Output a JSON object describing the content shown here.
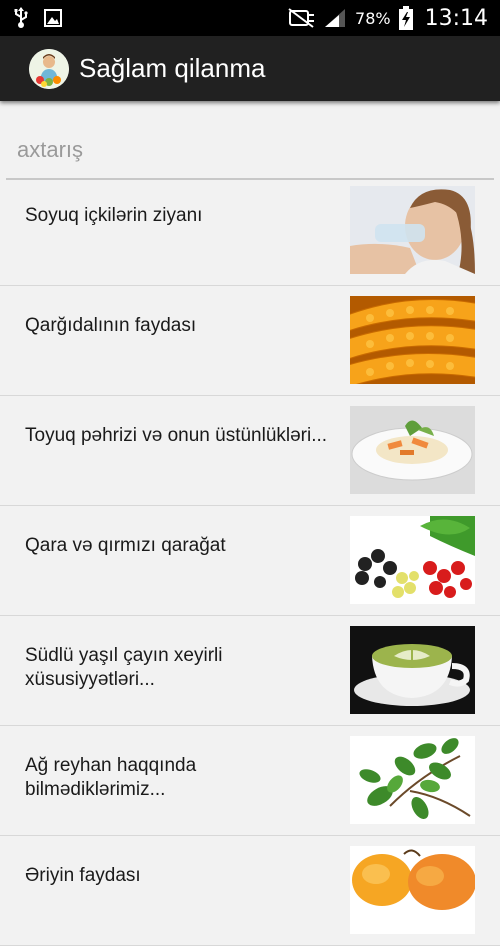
{
  "status_bar": {
    "battery_percent": "78%",
    "time": "13:14",
    "icons": [
      "usb-icon",
      "image-icon",
      "mute-icon",
      "signal-icon",
      "battery-charging-icon"
    ]
  },
  "app_bar": {
    "title": "Sağlam qilanma",
    "logo": "app-logo-icon"
  },
  "search": {
    "placeholder": "axtarış"
  },
  "list": {
    "items": [
      {
        "title": "Soyuq içkilərin ziyanı",
        "image": "woman-drinking-water"
      },
      {
        "title": "Qarğıdalının faydası",
        "image": "corn"
      },
      {
        "title": "Toyuq pəhrizi və onun üstünlükləri...",
        "image": "chicken-salad"
      },
      {
        "title": "Qara və qırmızı qarağat",
        "image": "currants"
      },
      {
        "title": "Südlü yaşıl çayın xeyirli xüsusiyyətləri...",
        "image": "green-tea-cup"
      },
      {
        "title": "Ağ reyhan haqqında bilmədiklərimiz...",
        "image": "basil"
      },
      {
        "title": "Əriyin faydası",
        "image": "apricots"
      }
    ]
  }
}
